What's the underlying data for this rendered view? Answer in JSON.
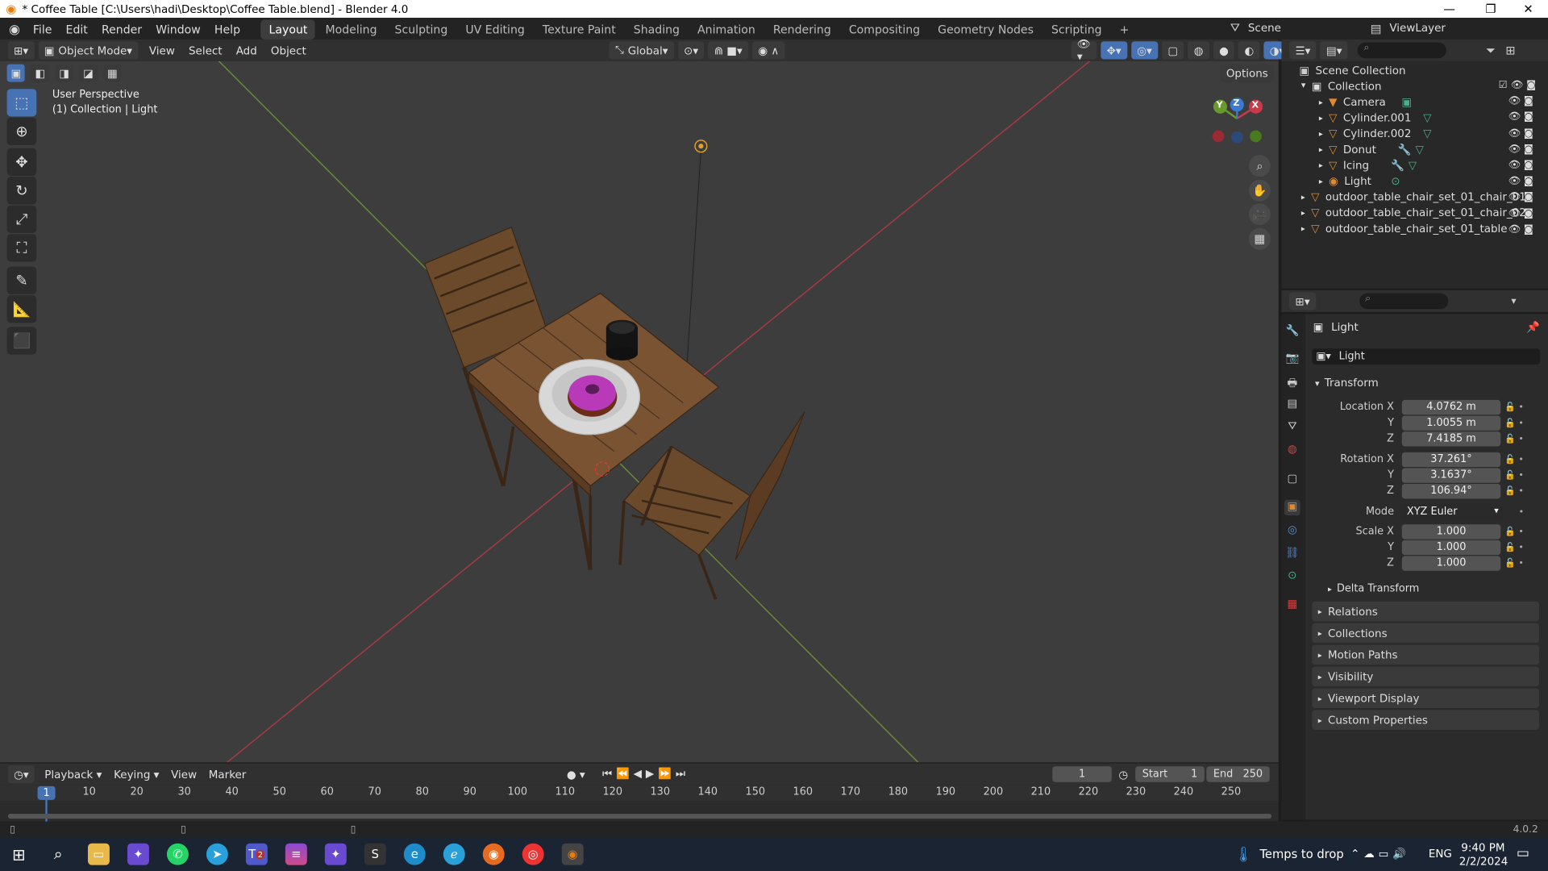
{
  "title_bar": {
    "title": "* Coffee Table [C:\\Users\\hadi\\Desktop\\Coffee Table.blend] - Blender 4.0",
    "minimize": "—",
    "maximize": "❐",
    "close": "✕"
  },
  "menu": [
    "File",
    "Edit",
    "Render",
    "Window",
    "Help"
  ],
  "workspaces": [
    "Layout",
    "Modeling",
    "Sculpting",
    "UV Editing",
    "Texture Paint",
    "Shading",
    "Animation",
    "Rendering",
    "Compositing",
    "Geometry Nodes",
    "Scripting"
  ],
  "workspace_active": "Layout",
  "add_workspace": "+",
  "scene": {
    "label": "Scene",
    "view_layer": "ViewLayer"
  },
  "viewport_header": {
    "mode": "Object Mode",
    "menus": [
      "View",
      "Select",
      "Add",
      "Object"
    ],
    "orientation": "Global",
    "options": "Options"
  },
  "viewport": {
    "perspective": "User Perspective",
    "collection_info": "(1) Collection | Light",
    "gizmo_axes": {
      "x": "X",
      "y": "Y",
      "z": "Z"
    }
  },
  "outliner": {
    "search_placeholder": "",
    "root": "Scene Collection",
    "collection": "Collection",
    "children": [
      "Camera",
      "Cylinder.001",
      "Cylinder.002",
      "Donut",
      "Icing",
      "Light"
    ],
    "top_level": [
      "outdoor_table_chair_set_01_chair_01",
      "outdoor_table_chair_set_01_chair_02",
      "outdoor_table_chair_set_01_table"
    ]
  },
  "properties": {
    "object_name": "Light",
    "data_name": "Light",
    "transform_label": "Transform",
    "location": {
      "label": "Location X",
      "x": "4.0762 m",
      "y": "1.0055 m",
      "z": "7.4185 m"
    },
    "rotation": {
      "label": "Rotation X",
      "x": "37.261°",
      "y": "3.1637°",
      "z": "106.94°"
    },
    "mode": {
      "label": "Mode",
      "value": "XYZ Euler"
    },
    "scale": {
      "label": "Scale X",
      "x": "1.000",
      "y": "1.000",
      "z": "1.000"
    },
    "axis_y": "Y",
    "axis_z": "Z",
    "delta_transform": "Delta Transform",
    "panels": [
      "Relations",
      "Collections",
      "Motion Paths",
      "Visibility",
      "Viewport Display",
      "Custom Properties"
    ]
  },
  "timeline": {
    "menus": [
      "Playback",
      "Keying",
      "View",
      "Marker"
    ],
    "current_frame": "1",
    "start_label": "Start",
    "start": "1",
    "end_label": "End",
    "end": "250",
    "ticks": [
      "1",
      "10",
      "20",
      "30",
      "40",
      "50",
      "60",
      "70",
      "80",
      "90",
      "100",
      "110",
      "120",
      "130",
      "140",
      "150",
      "160",
      "170",
      "180",
      "190",
      "200",
      "210",
      "220",
      "230",
      "240",
      "250"
    ]
  },
  "status_bar": {
    "version": "4.0.2"
  },
  "taskbar": {
    "weather": "Temps to drop",
    "language": "ENG",
    "time": "9:40 PM",
    "date": "2/2/2024",
    "teams_badge": "2"
  },
  "colors": {
    "accent": "#4772b3",
    "x_axis": "#c73a4a",
    "y_axis": "#6a9a2e",
    "z_axis": "#3b7ad0",
    "light_orange": "#e08a30"
  }
}
